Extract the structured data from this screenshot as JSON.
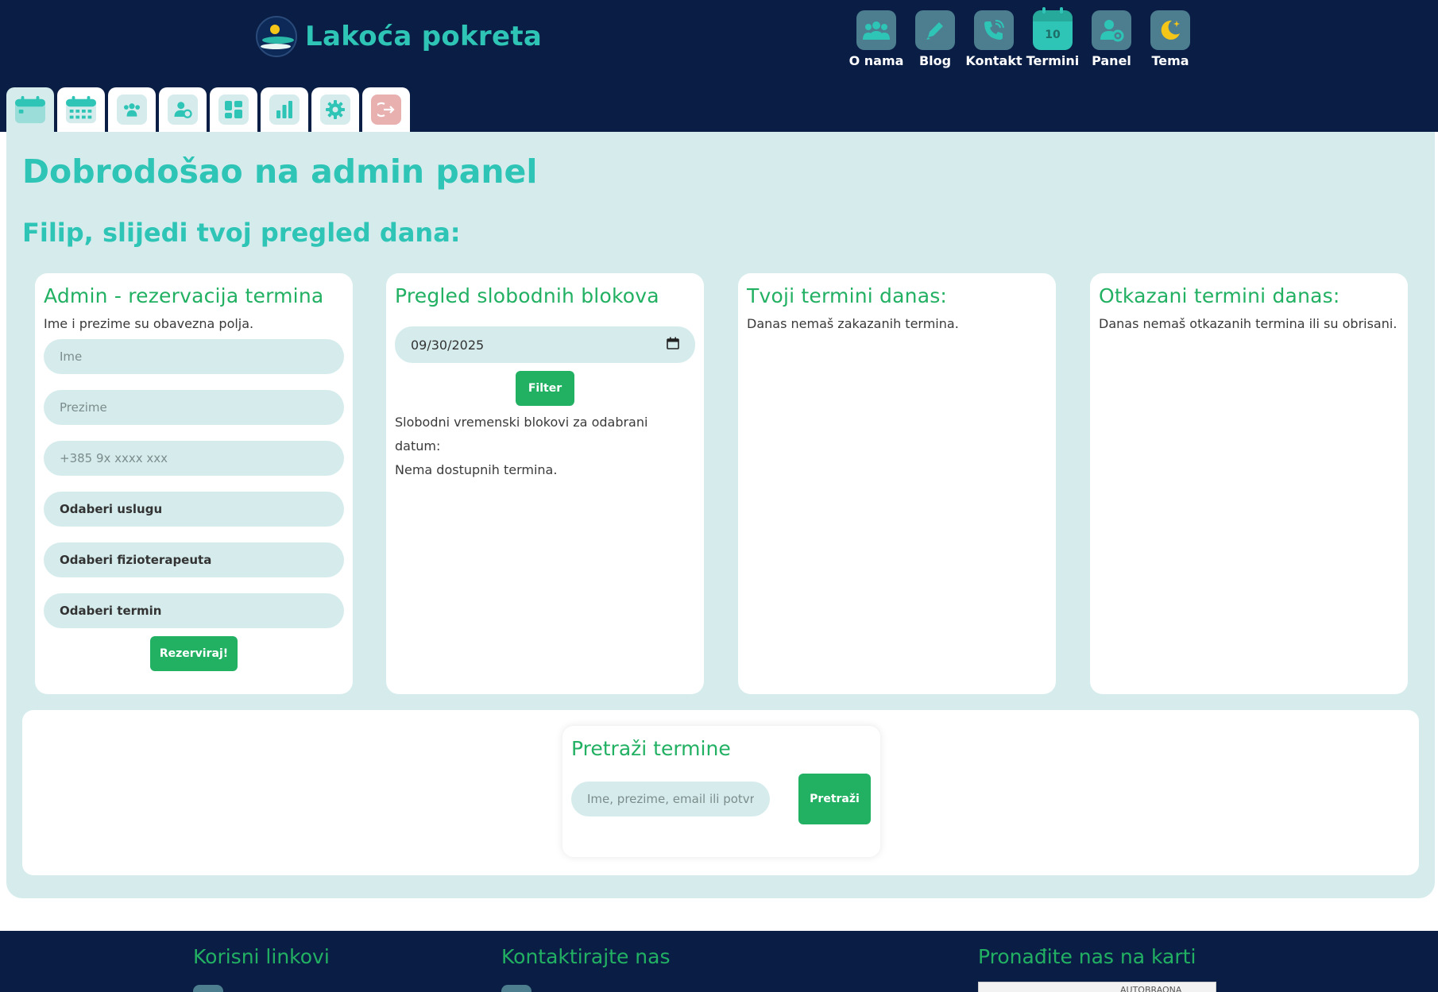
{
  "header": {
    "logo_text": "Lakoća pokreta",
    "nav": [
      {
        "label": "O nama",
        "icon": "users-icon"
      },
      {
        "label": "Blog",
        "icon": "pencil-icon"
      },
      {
        "label": "Kontakt",
        "icon": "phone-icon"
      },
      {
        "label": "Termini",
        "icon": "calendar-icon",
        "badge": "10"
      },
      {
        "label": "Panel",
        "icon": "user-gear-icon"
      },
      {
        "label": "Tema",
        "icon": "moon-icon"
      }
    ],
    "tabs": [
      {
        "icon": "calendar-day-icon",
        "active": true
      },
      {
        "icon": "calendar-grid-icon"
      },
      {
        "icon": "users-icon"
      },
      {
        "icon": "user-gear-icon"
      },
      {
        "icon": "dashboard-icon"
      },
      {
        "icon": "bar-chart-icon"
      },
      {
        "icon": "gear-icon"
      },
      {
        "icon": "logout-icon"
      }
    ]
  },
  "panel": {
    "title": "Dobrodošao na admin panel",
    "subtitle": "Filip, slijedi tvoj pregled dana:"
  },
  "booking": {
    "title": "Admin - rezervacija termina",
    "note": "Ime i prezime su obavezna polja.",
    "first_name_placeholder": "Ime",
    "last_name_placeholder": "Prezime",
    "phone_placeholder": "+385 9x xxxx xxx",
    "service_select": "Odaberi uslugu",
    "therapist_select": "Odaberi fizioterapeuta",
    "slot_select": "Odaberi termin",
    "submit_label": "Rezerviraj!"
  },
  "free_blocks": {
    "title": "Pregled slobodnih blokova",
    "date_value": "09/30/2025",
    "filter_label": "Filter",
    "info_text": "Slobodni vremenski blokovi za odabrani datum:",
    "empty_text": "Nema dostupnih termina."
  },
  "today": {
    "title": "Tvoji termini danas:",
    "empty_text": "Danas nemaš zakazanih termina."
  },
  "cancelled": {
    "title": "Otkazani termini danas:",
    "empty_text": "Danas nemaš otkazanih termina ili su obrisani."
  },
  "search": {
    "title": "Pretraži termine",
    "placeholder": "Ime, prezime, email ili potvrda",
    "button_label": "Pretraži"
  },
  "footer": {
    "links_title": "Korisni linkovi",
    "contact_title": "Kontaktirajte nas",
    "map_title": "Pronađite nas na karti",
    "map_label": "AUTOBRAONA"
  },
  "colors": {
    "navy": "#0a1e45",
    "teal": "#2ec4b6",
    "green": "#22b063",
    "light_teal": "#d6ecec",
    "icon_bg": "#4d7e8f",
    "logout_bg": "#e8b1b0"
  }
}
